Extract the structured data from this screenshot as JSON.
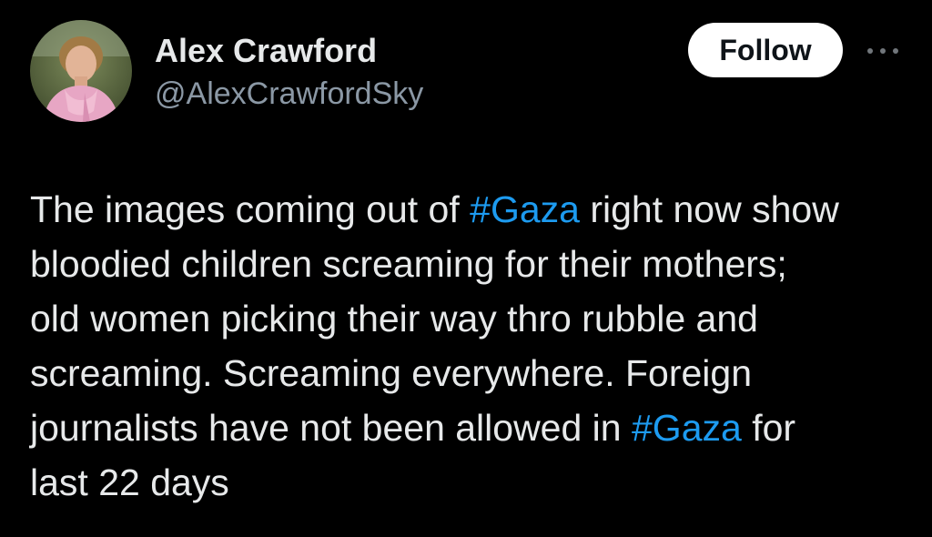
{
  "author": {
    "display_name": "Alex Crawford",
    "handle": "@AlexCrawfordSky"
  },
  "actions": {
    "follow_label": "Follow",
    "more_icon": "more-horizontal-icon"
  },
  "tweet": {
    "lines": [
      {
        "before": "The images coming out of ",
        "hashtag": "#Gaza",
        "after": " right now show"
      },
      {
        "text": "bloodied children screaming for their mothers;"
      },
      {
        "text": "old women picking their way thro rubble and"
      },
      {
        "text": "screaming. Screaming everywhere. Foreign"
      },
      {
        "before": "journalists have not been allowed in ",
        "hashtag": "#Gaza",
        "after": " for"
      },
      {
        "text": "last 22 days"
      }
    ]
  },
  "colors": {
    "background": "#000000",
    "text": "#e7e9ea",
    "secondary_text": "#8b98a5",
    "hashtag": "#1d9bf0",
    "follow_button_bg": "#ffffff",
    "follow_button_text": "#0f1419"
  }
}
